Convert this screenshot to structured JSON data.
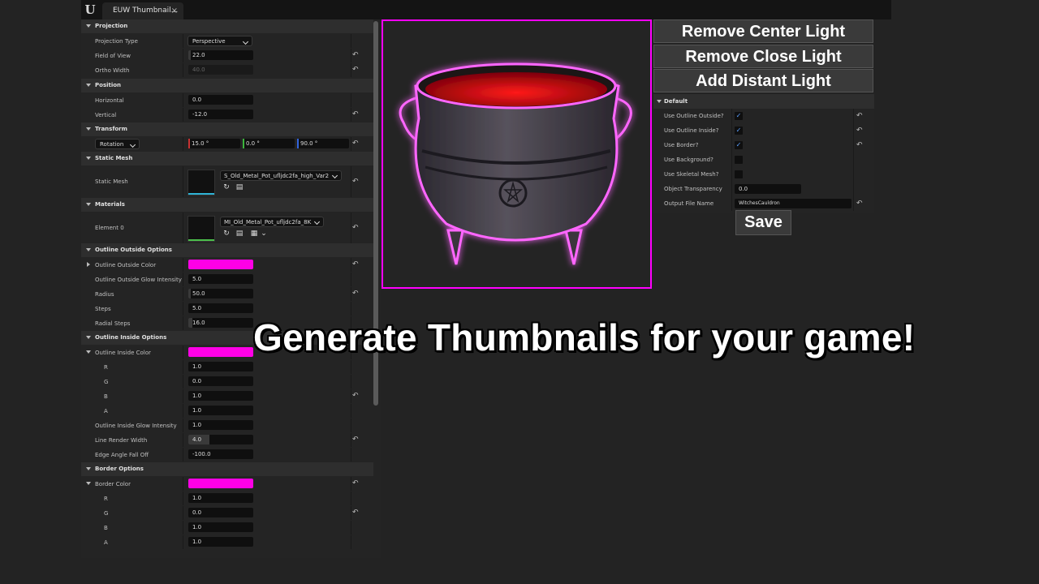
{
  "window": {
    "tab_title": "EUW Thumbnail...",
    "close_glyph": "×",
    "logo": "U"
  },
  "left_panel": {
    "projection": {
      "header": "Projection",
      "projection_type_label": "Projection Type",
      "projection_type_value": "Perspective",
      "fov_label": "Field of View",
      "fov_value": "22.0",
      "ortho_label": "Ortho Width",
      "ortho_value": "40.0"
    },
    "position": {
      "header": "Position",
      "horizontal_label": "Horizontal",
      "horizontal_value": "0.0",
      "vertical_label": "Vertical",
      "vertical_value": "-12.0"
    },
    "transform": {
      "header": "Transform",
      "rotation_label": "Rotation",
      "rot_x": "15.0 °",
      "rot_y": "0.0 °",
      "rot_z": "90.0 °"
    },
    "static_mesh": {
      "header": "Static Mesh",
      "label": "Static Mesh",
      "asset": "S_Old_Metal_Pot_ufljdc2fa_high_Var2"
    },
    "materials": {
      "header": "Materials",
      "label": "Element 0",
      "asset": "MI_Old_Metal_Pot_ufljdc2fa_8K"
    },
    "outline_outside": {
      "header": "Outline Outside Options",
      "color_label": "Outline Outside Color",
      "glow_label": "Outline Outside Glow Intensity",
      "glow_value": "5.0",
      "radius_label": "Radius",
      "radius_value": "50.0",
      "steps_label": "Steps",
      "steps_value": "5.0",
      "radial_label": "Radial Steps",
      "radial_value": "16.0"
    },
    "outline_inside": {
      "header": "Outline Inside Options",
      "color_label": "Outline Inside Color",
      "r_label": "R",
      "r_value": "1.0",
      "g_label": "G",
      "g_value": "0.0",
      "b_label": "B",
      "b_value": "1.0",
      "a_label": "A",
      "a_value": "1.0",
      "glow_label": "Outline Inside Glow Intensity",
      "glow_value": "1.0",
      "line_label": "Line Render Width",
      "line_value": "4.0",
      "edge_label": "Edge Angle Fall Off",
      "edge_value": "-100.0"
    },
    "border": {
      "header": "Border Options",
      "color_label": "Border Color",
      "r_label": "R",
      "r_value": "1.0",
      "g_label": "G",
      "g_value": "0.0",
      "b_label": "B",
      "b_value": "1.0",
      "a_label": "A",
      "a_value": "1.0"
    }
  },
  "buttons": {
    "remove_center": "Remove Center Light",
    "remove_close": "Remove Close Light",
    "add_distant": "Add Distant Light",
    "save": "Save"
  },
  "right_panel": {
    "header": "Default",
    "use_outline_outside": "Use Outline Outside?",
    "use_outline_inside": "Use Outline Inside?",
    "use_border": "Use Border?",
    "use_background": "Use Background?",
    "use_skeletal": "Use Skeletal Mesh?",
    "transparency_label": "Object Transparency",
    "transparency_value": "0.0",
    "output_label": "Output File Name",
    "output_value": "WitchesCauldron",
    "check_glyph": "✓"
  },
  "headline": "Generate Thumbnails for your game!",
  "colors": {
    "accent_magenta": "#ff00e6",
    "panel": "#242424",
    "background": "#232323"
  },
  "icons": [
    "unreal-logo-icon",
    "reset-arrow-icon",
    "browse-icon",
    "use-selected-icon",
    "checkerboard-icon",
    "chevron-down-icon",
    "checkbox-check-icon"
  ]
}
